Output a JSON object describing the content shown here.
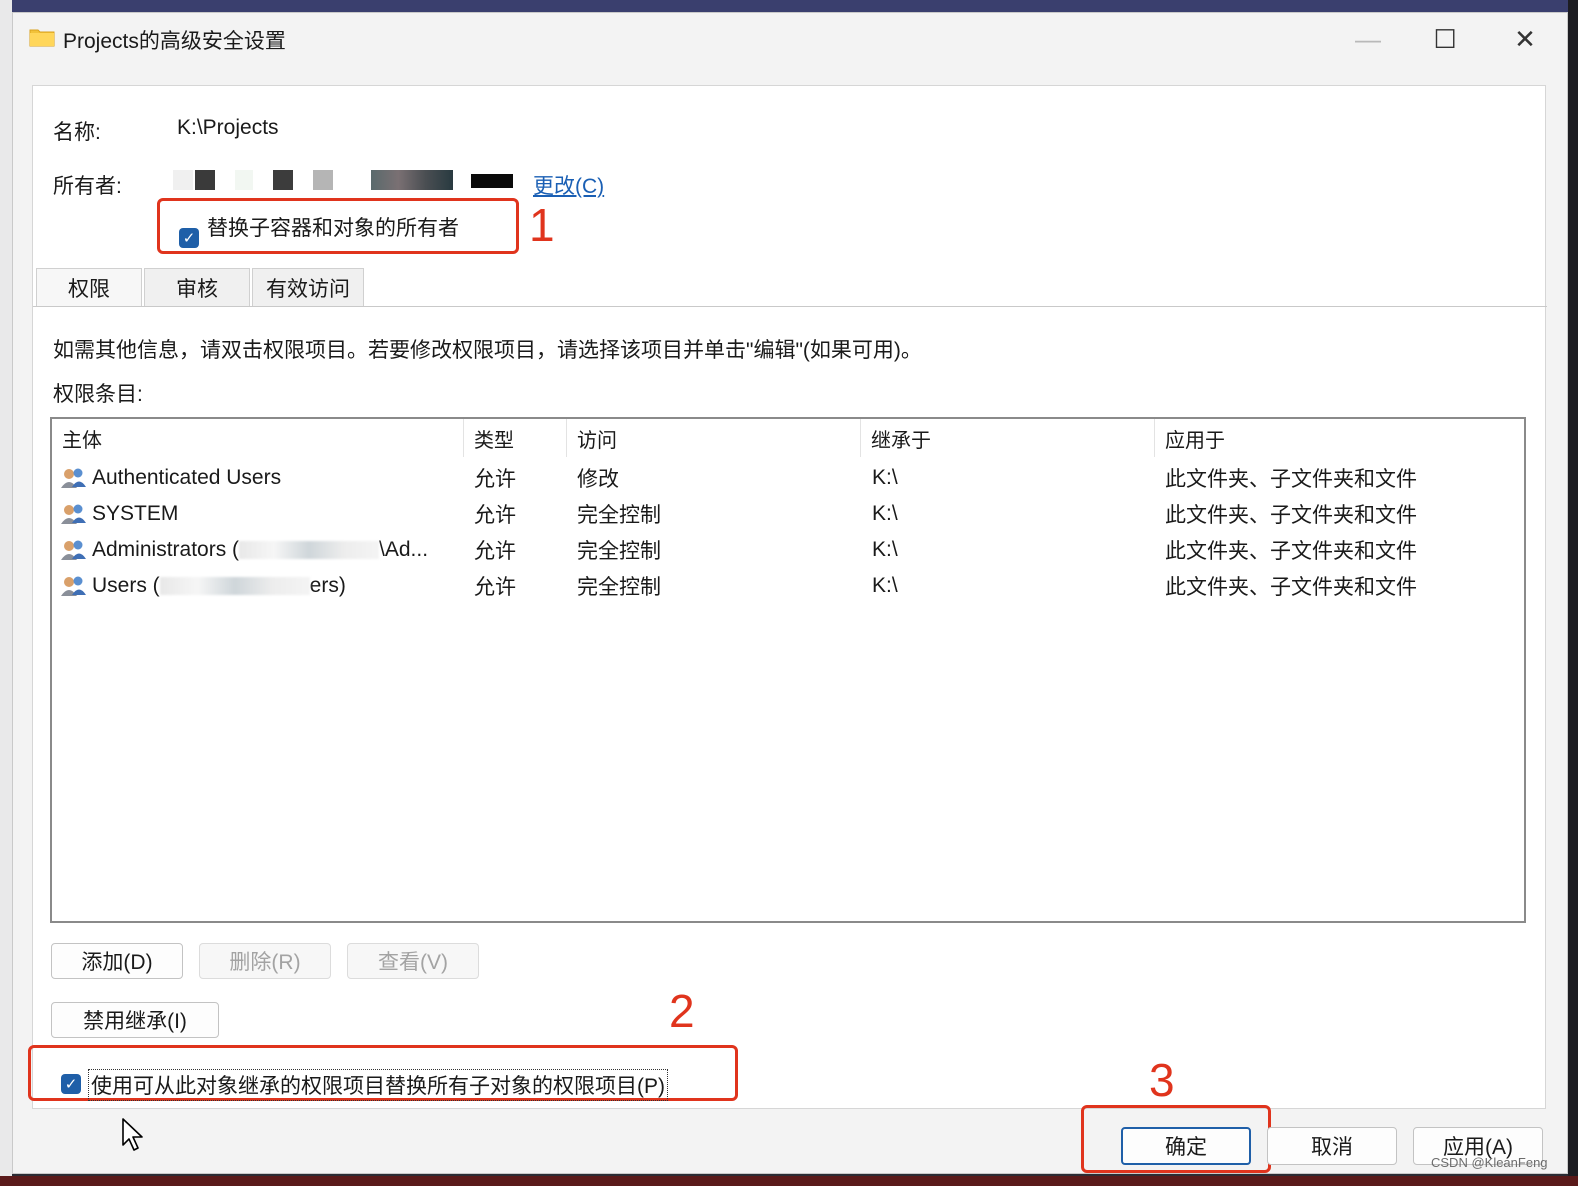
{
  "window": {
    "title": "Projects的高级安全设置",
    "controls": {
      "minimize": "—",
      "maximize": "☐",
      "close": "✕"
    }
  },
  "general": {
    "name_label": "名称:",
    "name_value": "K:\\Projects",
    "owner_label": "所有者:",
    "change_link": "更改(C)",
    "replace_owner_checkbox": {
      "label": "替换子容器和对象的所有者",
      "checked": true
    }
  },
  "tabs": [
    {
      "label": "权限",
      "active": true
    },
    {
      "label": "审核",
      "active": false
    },
    {
      "label": "有效访问",
      "active": false
    }
  ],
  "info_text": "如需其他信息，请双击权限项目。若要修改权限项目，请选择该项目并单击\"编辑\"(如果可用)。",
  "entries_label": "权限条目:",
  "table": {
    "columns": [
      "主体",
      "类型",
      "访问",
      "继承于",
      "应用于"
    ],
    "rows": [
      {
        "principal": "Authenticated Users",
        "type": "允许",
        "access": "修改",
        "inherited_from": "K:\\",
        "applies_to": "此文件夹、子文件夹和文件"
      },
      {
        "principal": "SYSTEM",
        "type": "允许",
        "access": "完全控制",
        "inherited_from": "K:\\",
        "applies_to": "此文件夹、子文件夹和文件"
      },
      {
        "principal": "Administrators (",
        "principal_suffix": "\\Ad...",
        "type": "允许",
        "access": "完全控制",
        "inherited_from": "K:\\",
        "applies_to": "此文件夹、子文件夹和文件"
      },
      {
        "principal": "Users (",
        "principal_suffix": "ers)",
        "type": "允许",
        "access": "完全控制",
        "inherited_from": "K:\\",
        "applies_to": "此文件夹、子文件夹和文件"
      }
    ]
  },
  "buttons": {
    "add": "添加(D)",
    "remove": "删除(R)",
    "view": "查看(V)",
    "disable_inheritance": "禁用继承(I)",
    "ok": "确定",
    "cancel": "取消",
    "apply": "应用(A)"
  },
  "replace_child_checkbox": {
    "label": "使用可从此对象继承的权限项目替换所有子对象的权限项目(P)",
    "checked": true
  },
  "annotations": {
    "n1": "1",
    "n2": "2",
    "n3": "3",
    "color": "#e0341d"
  },
  "watermark": "CSDN @KleanFeng",
  "colors": {
    "accent": "#1f5fa8",
    "link": "#1a5fb4",
    "annotation": "#e0341d"
  },
  "icons": {
    "title": "folder-icon",
    "principal": "users-group-icon",
    "pointer": "mouse-cursor-icon"
  }
}
